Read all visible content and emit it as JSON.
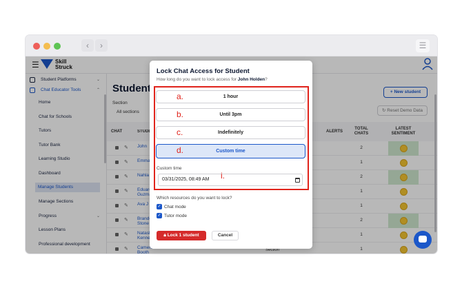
{
  "app": {
    "logo_line1": "Skill",
    "logo_line2": "Struck"
  },
  "sidebar": {
    "items": [
      {
        "label": "Student Platforms",
        "chevron": "⌄"
      },
      {
        "label": "Chat Educator Tools",
        "chevron": "⌃"
      },
      {
        "label": "Home"
      },
      {
        "label": "Chat for Schools"
      },
      {
        "label": "Tutors"
      },
      {
        "label": "Tutor Bank"
      },
      {
        "label": "Learning Studio"
      },
      {
        "label": "Dashboard"
      },
      {
        "label": "Manage Students"
      },
      {
        "label": "Manage Sections"
      },
      {
        "label": "Progress",
        "chevron": "⌄"
      },
      {
        "label": "Lesson Plans"
      },
      {
        "label": "Professional development"
      }
    ]
  },
  "main": {
    "title": "Students",
    "section_label": "Section",
    "section_value": "All sections",
    "new_student": "New student",
    "reset_demo": "Reset Demo Data",
    "headers": {
      "chat": "CHAT",
      "student": "STUDENT",
      "alerts": "ALERTS",
      "total_chats_1": "TOTAL",
      "total_chats_2": "CHATS",
      "sentiment_1": "LATEST",
      "sentiment_2": "SENTIMENT"
    },
    "rows": [
      {
        "name": "John",
        "chats": "2",
        "green": true
      },
      {
        "name": "Emma",
        "chats": "1",
        "green": false
      },
      {
        "name": "Nahla",
        "chats": "2",
        "green": true
      },
      {
        "name": "Eduardo Guzman",
        "chats": "1",
        "green": false
      },
      {
        "name": "Ava J",
        "chats": "1",
        "green": false
      },
      {
        "name": "Brandon Stone",
        "chats": "2",
        "green": true
      },
      {
        "name": "Natasha Kenne",
        "chats": "1",
        "green": false
      },
      {
        "name": "Cameron Booth",
        "chats": "1",
        "green": false
      }
    ],
    "trailing_text": "Section"
  },
  "modal": {
    "title": "Lock Chat Access for Student",
    "subtitle_prefix": "How long do you want to lock access for ",
    "student_name": "John Holden",
    "subtitle_suffix": "?",
    "options": [
      {
        "letter": "a.",
        "label": "1 hour"
      },
      {
        "letter": "b.",
        "label": "Until 3pm"
      },
      {
        "letter": "c.",
        "label": "Indefinitely"
      },
      {
        "letter": "d.",
        "label": "Custom time"
      }
    ],
    "custom_time_label": "Custom time",
    "custom_time_value": "03/31/2025, 08:49 AM",
    "custom_time_letter": "i.",
    "resources_question": "Which resources do you want to lock?",
    "resources": [
      {
        "label": "Chat mode",
        "checked": true
      },
      {
        "label": "Tutor mode",
        "checked": true
      }
    ],
    "lock_button": "Lock 1 student",
    "cancel_button": "Cancel"
  },
  "colors": {
    "accent": "#1b57c9",
    "danger": "#d52b2b",
    "annotation": "#e0231b",
    "sentiment_positive": "#cfe8cf"
  }
}
